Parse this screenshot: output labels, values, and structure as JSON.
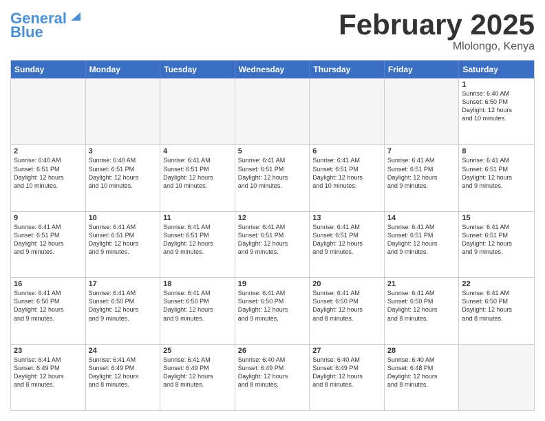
{
  "logo": {
    "line1": "General",
    "line2": "Blue"
  },
  "header": {
    "month": "February 2025",
    "location": "Mlolongo, Kenya"
  },
  "dayNames": [
    "Sunday",
    "Monday",
    "Tuesday",
    "Wednesday",
    "Thursday",
    "Friday",
    "Saturday"
  ],
  "weeks": [
    [
      {
        "date": "",
        "info": ""
      },
      {
        "date": "",
        "info": ""
      },
      {
        "date": "",
        "info": ""
      },
      {
        "date": "",
        "info": ""
      },
      {
        "date": "",
        "info": ""
      },
      {
        "date": "",
        "info": ""
      },
      {
        "date": "1",
        "info": "Sunrise: 6:40 AM\nSunset: 6:50 PM\nDaylight: 12 hours\nand 10 minutes."
      }
    ],
    [
      {
        "date": "2",
        "info": "Sunrise: 6:40 AM\nSunset: 6:51 PM\nDaylight: 12 hours\nand 10 minutes."
      },
      {
        "date": "3",
        "info": "Sunrise: 6:40 AM\nSunset: 6:51 PM\nDaylight: 12 hours\nand 10 minutes."
      },
      {
        "date": "4",
        "info": "Sunrise: 6:41 AM\nSunset: 6:51 PM\nDaylight: 12 hours\nand 10 minutes."
      },
      {
        "date": "5",
        "info": "Sunrise: 6:41 AM\nSunset: 6:51 PM\nDaylight: 12 hours\nand 10 minutes."
      },
      {
        "date": "6",
        "info": "Sunrise: 6:41 AM\nSunset: 6:51 PM\nDaylight: 12 hours\nand 10 minutes."
      },
      {
        "date": "7",
        "info": "Sunrise: 6:41 AM\nSunset: 6:51 PM\nDaylight: 12 hours\nand 9 minutes."
      },
      {
        "date": "8",
        "info": "Sunrise: 6:41 AM\nSunset: 6:51 PM\nDaylight: 12 hours\nand 9 minutes."
      }
    ],
    [
      {
        "date": "9",
        "info": "Sunrise: 6:41 AM\nSunset: 6:51 PM\nDaylight: 12 hours\nand 9 minutes."
      },
      {
        "date": "10",
        "info": "Sunrise: 6:41 AM\nSunset: 6:51 PM\nDaylight: 12 hours\nand 9 minutes."
      },
      {
        "date": "11",
        "info": "Sunrise: 6:41 AM\nSunset: 6:51 PM\nDaylight: 12 hours\nand 9 minutes."
      },
      {
        "date": "12",
        "info": "Sunrise: 6:41 AM\nSunset: 6:51 PM\nDaylight: 12 hours\nand 9 minutes."
      },
      {
        "date": "13",
        "info": "Sunrise: 6:41 AM\nSunset: 6:51 PM\nDaylight: 12 hours\nand 9 minutes."
      },
      {
        "date": "14",
        "info": "Sunrise: 6:41 AM\nSunset: 6:51 PM\nDaylight: 12 hours\nand 9 minutes."
      },
      {
        "date": "15",
        "info": "Sunrise: 6:41 AM\nSunset: 6:51 PM\nDaylight: 12 hours\nand 9 minutes."
      }
    ],
    [
      {
        "date": "16",
        "info": "Sunrise: 6:41 AM\nSunset: 6:50 PM\nDaylight: 12 hours\nand 9 minutes."
      },
      {
        "date": "17",
        "info": "Sunrise: 6:41 AM\nSunset: 6:50 PM\nDaylight: 12 hours\nand 9 minutes."
      },
      {
        "date": "18",
        "info": "Sunrise: 6:41 AM\nSunset: 6:50 PM\nDaylight: 12 hours\nand 9 minutes."
      },
      {
        "date": "19",
        "info": "Sunrise: 6:41 AM\nSunset: 6:50 PM\nDaylight: 12 hours\nand 9 minutes."
      },
      {
        "date": "20",
        "info": "Sunrise: 6:41 AM\nSunset: 6:50 PM\nDaylight: 12 hours\nand 8 minutes."
      },
      {
        "date": "21",
        "info": "Sunrise: 6:41 AM\nSunset: 6:50 PM\nDaylight: 12 hours\nand 8 minutes."
      },
      {
        "date": "22",
        "info": "Sunrise: 6:41 AM\nSunset: 6:50 PM\nDaylight: 12 hours\nand 8 minutes."
      }
    ],
    [
      {
        "date": "23",
        "info": "Sunrise: 6:41 AM\nSunset: 6:49 PM\nDaylight: 12 hours\nand 8 minutes."
      },
      {
        "date": "24",
        "info": "Sunrise: 6:41 AM\nSunset: 6:49 PM\nDaylight: 12 hours\nand 8 minutes."
      },
      {
        "date": "25",
        "info": "Sunrise: 6:41 AM\nSunset: 6:49 PM\nDaylight: 12 hours\nand 8 minutes."
      },
      {
        "date": "26",
        "info": "Sunrise: 6:40 AM\nSunset: 6:49 PM\nDaylight: 12 hours\nand 8 minutes."
      },
      {
        "date": "27",
        "info": "Sunrise: 6:40 AM\nSunset: 6:49 PM\nDaylight: 12 hours\nand 8 minutes."
      },
      {
        "date": "28",
        "info": "Sunrise: 6:40 AM\nSunset: 6:48 PM\nDaylight: 12 hours\nand 8 minutes."
      },
      {
        "date": "",
        "info": ""
      }
    ]
  ]
}
